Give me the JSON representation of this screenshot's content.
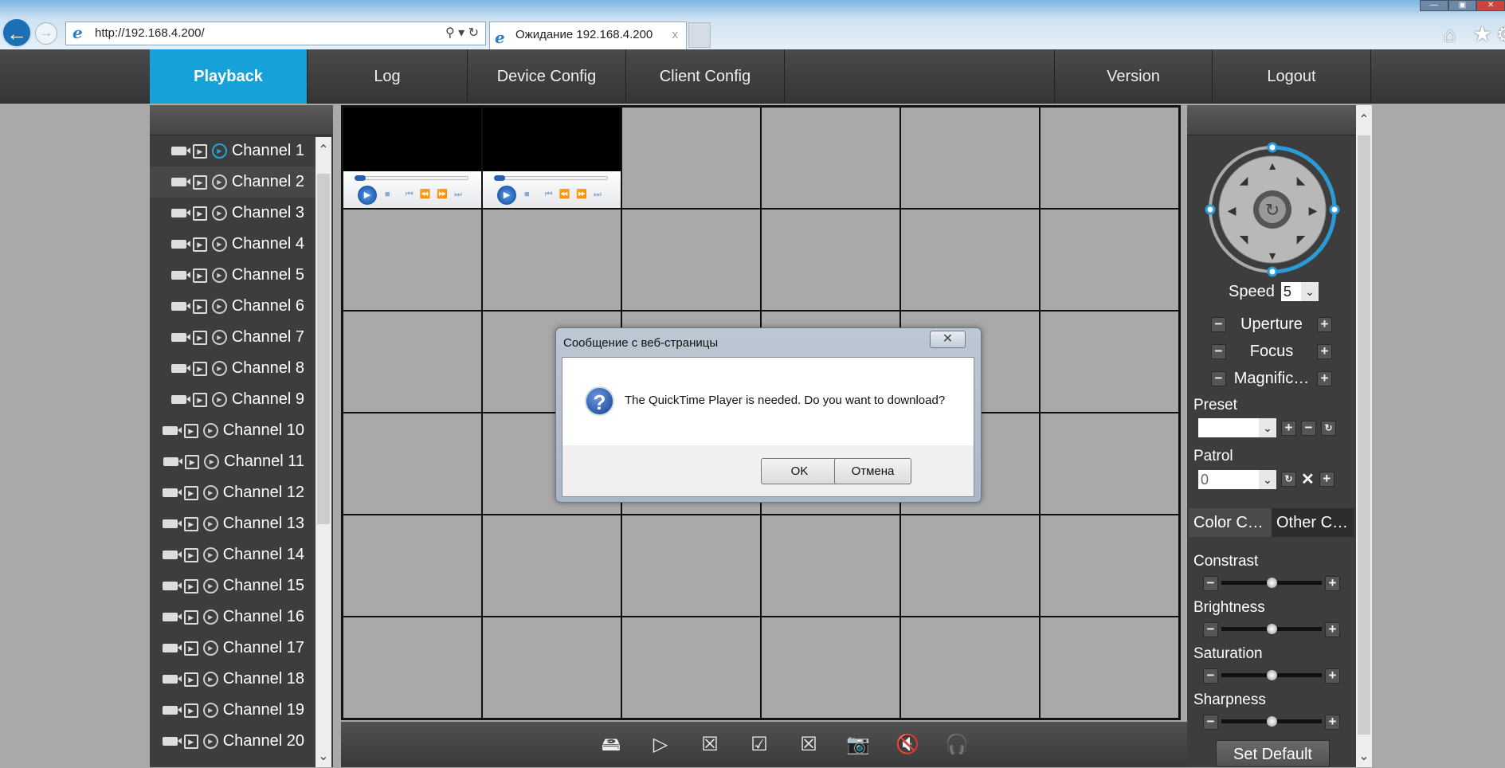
{
  "browser": {
    "address": "http://192.168.4.200/",
    "tab_title": "Ожидание 192.168.4.200",
    "tab_close": "x"
  },
  "nav": {
    "items": [
      {
        "label": "Playback",
        "active": true
      },
      {
        "label": "Log"
      },
      {
        "label": "Device Config"
      },
      {
        "label": "Client Config"
      },
      {
        "label": "Version"
      },
      {
        "label": "Logout"
      }
    ]
  },
  "channels": [
    "Channel 1",
    "Channel 2",
    "Channel 3",
    "Channel 4",
    "Channel 5",
    "Channel 6",
    "Channel 7",
    "Channel 8",
    "Channel 9",
    "Channel 10",
    "Channel 11",
    "Channel 12",
    "Channel 13",
    "Channel 14",
    "Channel 15",
    "Channel 16",
    "Channel 17",
    "Channel 18",
    "Channel 19",
    "Channel 20"
  ],
  "ptz": {
    "speed_label": "Speed",
    "speed_value": "5",
    "uperture": "Uperture",
    "focus": "Focus",
    "magnification": "Magnific…",
    "preset_label": "Preset",
    "preset_value": "",
    "patrol_label": "Patrol",
    "patrol_value": "0"
  },
  "color": {
    "tabs": [
      "Color C…",
      "Other C…"
    ],
    "sliders": [
      {
        "label": "Constrast",
        "value": 0.5
      },
      {
        "label": "Brightness",
        "value": 0.5
      },
      {
        "label": "Saturation",
        "value": 0.5
      },
      {
        "label": "Sharpness",
        "value": 0.5
      }
    ],
    "set_default": "Set Default"
  },
  "dialog": {
    "title": "Сообщение с веб-страницы",
    "message": "The QuickTime Player is needed. Do you want to download?",
    "ok": "OK",
    "cancel": "Отмена"
  },
  "colors": {
    "accent": "#16a1d8",
    "panel": "#3d3d3d"
  }
}
